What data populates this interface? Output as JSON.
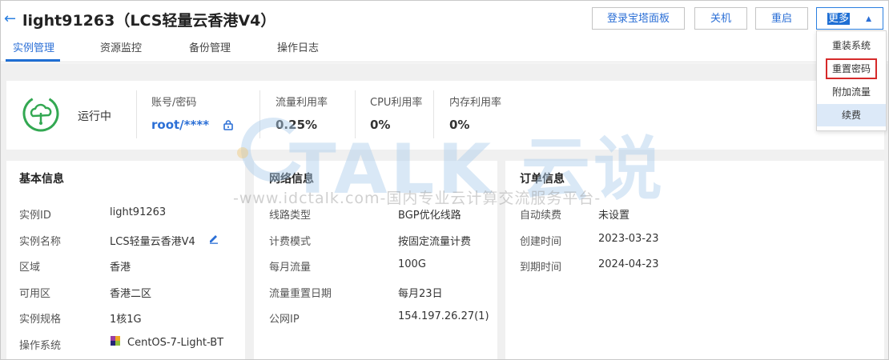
{
  "header": {
    "back_icon": "arrow-left-icon",
    "title": "light91263（LCS轻量云香港V4）",
    "buttons": {
      "login_panel": "登录宝塔面板",
      "shutdown": "关机",
      "restart": "重启",
      "more": "更多"
    }
  },
  "tabs": [
    {
      "label": "实例管理",
      "active": true
    },
    {
      "label": "资源监控",
      "active": false
    },
    {
      "label": "备份管理",
      "active": false
    },
    {
      "label": "操作日志",
      "active": false
    }
  ],
  "more_menu": {
    "items": [
      "重装系统",
      "重置密码",
      "附加流量",
      "续费"
    ],
    "boxed_item": "重置密码",
    "hovered_item": "续费"
  },
  "status": {
    "icon": "cloud-running-icon",
    "text": "运行中",
    "account": {
      "label": "账号/密码",
      "value": "root/****",
      "icon": "lock-icon"
    },
    "traffic": {
      "label": "流量利用率",
      "value": "0.25%"
    },
    "cpu": {
      "label": "CPU利用率",
      "value": "0%"
    },
    "memory": {
      "label": "内存利用率",
      "value": "0%"
    }
  },
  "basic_info": {
    "title": "基本信息",
    "rows": [
      {
        "label": "实例ID",
        "value": "light91263"
      },
      {
        "label": "实例名称",
        "value": "LCS轻量云香港V4"
      },
      {
        "label": "区域",
        "value": "香港"
      },
      {
        "label": "可用区",
        "value": "香港二区"
      },
      {
        "label": "实例规格",
        "value": "1核1G"
      },
      {
        "label": "操作系统",
        "value": "CentOS-7-Light-BT"
      }
    ]
  },
  "network_info": {
    "title": "网络信息",
    "rows": [
      {
        "label": "线路类型",
        "value": "BGP优化线路"
      },
      {
        "label": "计费模式",
        "value": "按固定流量计费"
      },
      {
        "label": "每月流量",
        "value": "100G"
      },
      {
        "label": "流量重置日期",
        "value": "每月23日"
      },
      {
        "label": "公网IP",
        "value": "154.197.26.27(1)"
      }
    ]
  },
  "order_info": {
    "title": "订单信息",
    "rows": [
      {
        "label": "自动续费",
        "value": "未设置"
      },
      {
        "label": "创建时间",
        "value": "2023-03-23"
      },
      {
        "label": "到期时间",
        "value": "2024-04-23"
      }
    ]
  },
  "watermark": {
    "brand": "TALK 云说",
    "url": "-www.idctalk.com-国内专业云计算交流服务平台-"
  },
  "colors": {
    "accent": "#1f6fd4",
    "running_green": "#33a852",
    "highlight_box": "#d62a2a"
  }
}
